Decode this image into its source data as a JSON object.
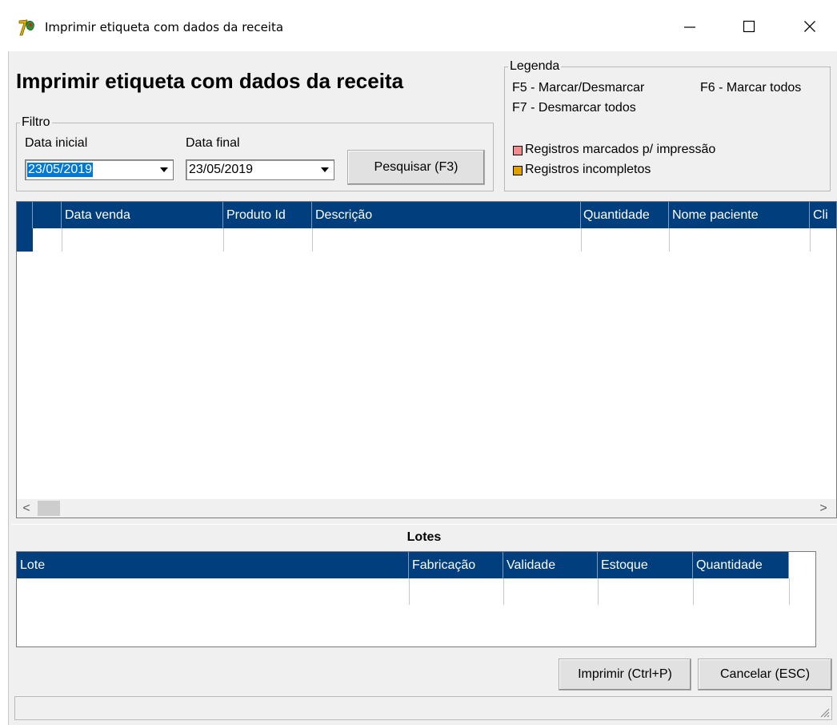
{
  "window": {
    "title": "Imprimir etiqueta com dados da receita",
    "minimize": "—",
    "maximize": "☐",
    "close": "✕"
  },
  "form": {
    "heading": "Imprimir etiqueta com dados da receita"
  },
  "filter": {
    "group_label": "Filtro",
    "start_label": "Data inicial",
    "start_value": "23/05/2019",
    "end_label": "Data final",
    "end_value": "23/05/2019",
    "search_button": "Pesquisar (F3)"
  },
  "legend": {
    "group_label": "Legenda",
    "f5": "F5 - Marcar/Desmarcar",
    "f6": "F6 - Marcar todos",
    "f7": "F7 - Desmarcar todos",
    "marked_label": "Registros marcados p/ impressão",
    "marked_color": "#f28b8b",
    "incomplete_label": "Registros incompletos",
    "incomplete_color": "#e0a000"
  },
  "sales_grid": {
    "columns": [
      "Data venda",
      "Produto Id",
      "Descrição",
      "Quantidade",
      "Nome paciente",
      "Cli"
    ],
    "scroll_left": "<",
    "scroll_right": ">"
  },
  "lotes": {
    "title": "Lotes",
    "columns": [
      "Lote",
      "Fabricação",
      "Validade",
      "Estoque",
      "Quantidade"
    ]
  },
  "actions": {
    "print_button": "Imprimir (Ctrl+P)",
    "cancel_button": "Cancelar (ESC)"
  },
  "colors": {
    "grid_header": "#003e7e",
    "selection": "#0078d7"
  }
}
